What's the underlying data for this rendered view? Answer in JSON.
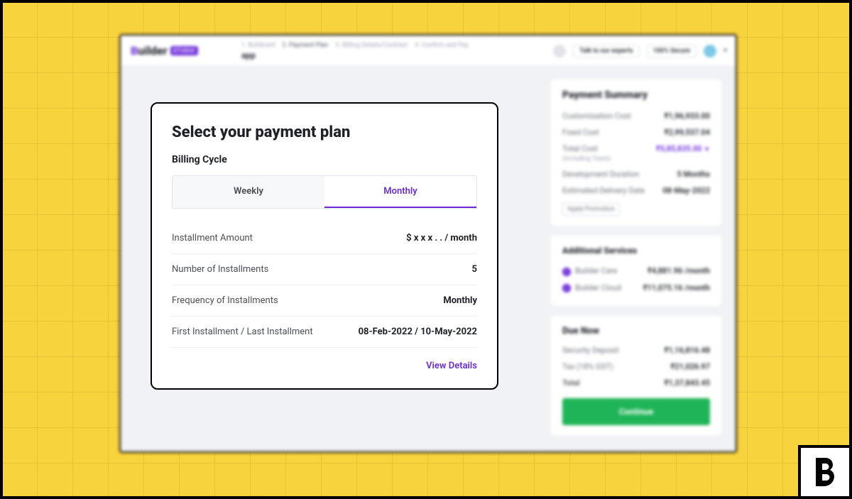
{
  "header": {
    "logo_text": "Builder",
    "logo_badge": "STUDIO",
    "breadcrumbs": [
      "1. Buildcard",
      "2. Payment Plan",
      "3. Billing Details/Contract",
      "4. Confirm and Pay"
    ],
    "active_breadcrumb_index": 1,
    "app_name": "app",
    "talk_to_experts": "Talk to our experts",
    "secure_badge": "100% Secure"
  },
  "modal": {
    "title": "Select your payment plan",
    "subtitle": "Billing Cycle",
    "tabs": {
      "weekly": "Weekly",
      "monthly": "Monthly"
    },
    "rows": {
      "installment_amount": {
        "label": "Installment Amount",
        "value": "$ x x x . . / month"
      },
      "num_installments": {
        "label": "Number of Installments",
        "value": "5"
      },
      "frequency": {
        "label": "Frequency of Installments",
        "value": "Monthly"
      },
      "first_last": {
        "label": "First Installment / Last Installment",
        "value": "08-Feb-2022 / 10-May-2022"
      }
    },
    "view_details": "View Details"
  },
  "summary": {
    "title": "Payment Summary",
    "customisation": {
      "label": "Customisation Cost",
      "value": "₹1,96,933.00"
    },
    "fixed": {
      "label": "Fixed Cost",
      "value": "₹2,99,537.04"
    },
    "total": {
      "label": "Total Cost",
      "sublabel": "(Including Taxes)",
      "value": "₹5,85,835.00"
    },
    "dev_duration": {
      "label": "Development Duration",
      "value": "5 Months"
    },
    "delivery": {
      "label": "Estimated Delivery Date",
      "value": "08-May-2022"
    },
    "promo_button": "Apply Promotion"
  },
  "services": {
    "title": "Additional Services",
    "items": [
      {
        "name": "Builder Care",
        "price": "₹4,881.96 /month"
      },
      {
        "name": "Builder Cloud",
        "price": "₹11,075.16 /month"
      }
    ]
  },
  "due": {
    "title": "Due Now",
    "deposit": {
      "label": "Security Deposit",
      "value": "₹1,16,816.48"
    },
    "tax": {
      "label": "Tax (18% GST)",
      "value": "₹21,026.97"
    },
    "total": {
      "label": "Total",
      "value": "₹1,37,843.45"
    },
    "continue": "Continue"
  }
}
